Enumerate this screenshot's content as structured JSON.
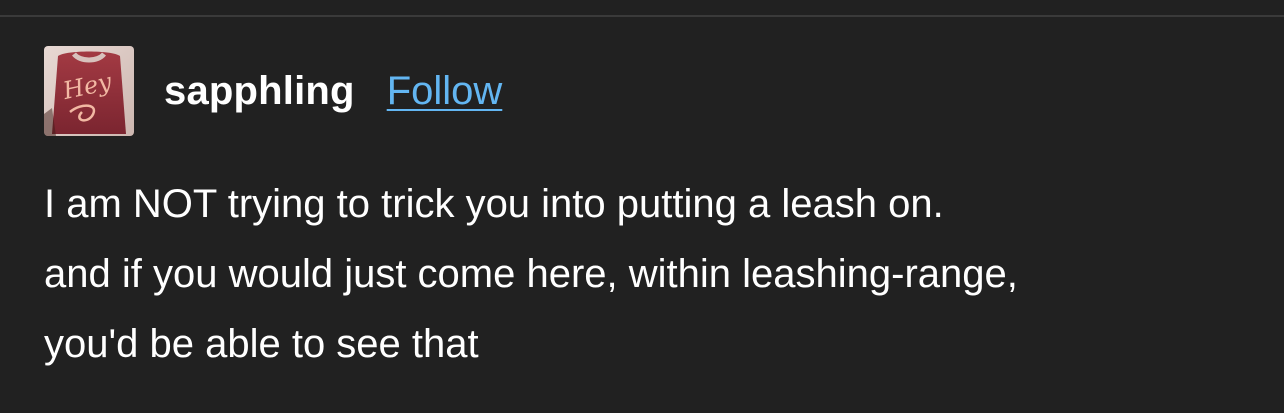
{
  "post": {
    "username": "sapphling",
    "follow_label": "Follow",
    "avatar": {
      "icon": "avatar-shirt-image",
      "shirt_text": "Hey"
    },
    "body_lines": [
      "I am NOT trying to trick you into putting a leash on.",
      "and if you would just come here, within leashing-range,",
      "you'd be able to see that"
    ]
  },
  "colors": {
    "background": "#212121",
    "text": "#ffffff",
    "link": "#63b6f2",
    "divider": "#3a3a3a"
  }
}
